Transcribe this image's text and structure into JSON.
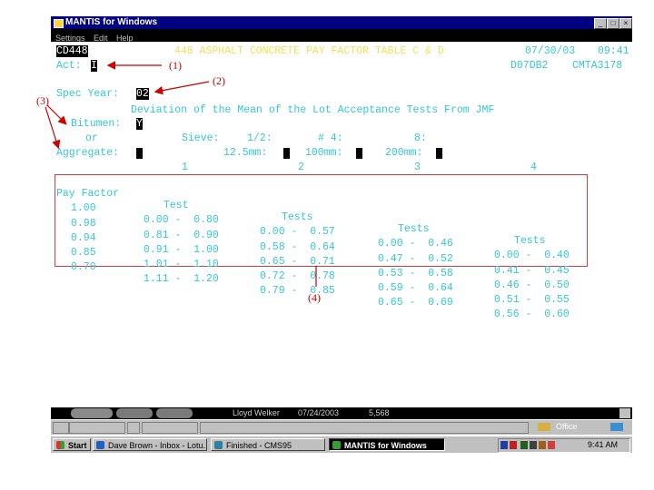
{
  "window": {
    "title": "MANTIS for Windows"
  },
  "menu": [
    "Settings",
    "Edit",
    "Help"
  ],
  "header": {
    "screen_id": "CD448",
    "title": "448 ASPHALT CONCRETE PAY FACTOR TABLE C & D",
    "date": "07/30/03",
    "time": "09:41",
    "code1": "D07DB2",
    "code2": "CMTA3178"
  },
  "form": {
    "act_label": "Act:",
    "act_value": "I",
    "spec_year_label": "Spec Year:",
    "spec_year_value": "02",
    "deviation_title": "Deviation of the Mean of the Lot Acceptance Tests From JMF",
    "bitumen_label": "Bitumen:",
    "bitumen_value": "Y",
    "or_label": "or",
    "sieve_label": "Sieve:",
    "sieve_half": "1/2:",
    "sieve_no4": "# 4:",
    "sieve_8": "8:",
    "aggregate_label": "Aggregate:",
    "mm_125": "12.5mm:",
    "mm_100": "100mm:",
    "mm_200": "200mm:"
  },
  "table": {
    "col_numbers": [
      "1",
      "2",
      "3",
      "4"
    ],
    "headers": [
      "Pay Factor",
      "Test",
      "Tests",
      "Tests",
      "Tests"
    ],
    "rows": [
      [
        "1.00",
        "0.00 -  0.80",
        "0.00 -  0.57",
        "0.00 -  0.46",
        "0.00 -  0.40"
      ],
      [
        "0.98",
        "0.81 -  0.90",
        "0.58 -  0.64",
        "0.47 -  0.52",
        "0.41 -  0.45"
      ],
      [
        "0.94",
        "0.91 -  1.00",
        "0.65 -  0.71",
        "0.53 -  0.58",
        "0.46 -  0.50"
      ],
      [
        "0.85",
        "1.01 -  1.10",
        "0.72 -  0.78",
        "0.59 -  0.64",
        "0.51 -  0.55"
      ],
      [
        "0.70",
        "1.11 -  1.20",
        "0.79 -  0.85",
        "0.65 -  0.69",
        "0.56 -  0.60"
      ]
    ]
  },
  "annotations": [
    "(1)",
    "(2)",
    "(3)",
    "(4)"
  ],
  "status": {
    "user": "Lloyd Welker",
    "date": "07/24/2003",
    "count": "5,568",
    "office": "Office"
  },
  "taskbar": {
    "start": "Start",
    "tasks": [
      "Dave Brown - Inbox - Lotu...",
      "Finished - CMS95",
      "MANTIS for Windows"
    ],
    "clock": "9:41 AM"
  },
  "colors": {
    "field_text": "#35c8d6",
    "title_text": "#efe25a",
    "annotation": "#cc0000",
    "titlebar": "#000080"
  }
}
